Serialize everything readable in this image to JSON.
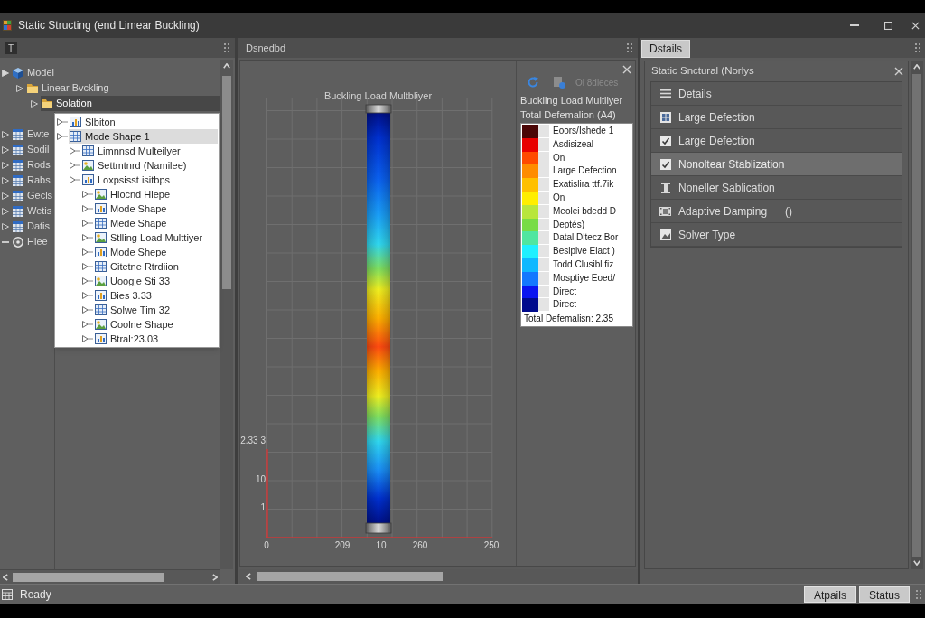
{
  "window": {
    "title": "Static Structing (end Limear Buckling)"
  },
  "left_panel": {
    "toolbar_button": "T",
    "tree": [
      {
        "label": "Model",
        "kind": "branch",
        "expanded": true,
        "selected": false,
        "children": [
          {
            "label": "Linear Bvckling",
            "kind": "branch",
            "expanded": false,
            "selected": false,
            "children": [
              {
                "label": "Solation",
                "kind": "branch",
                "expanded": false,
                "selected": true
              }
            ]
          }
        ]
      },
      {
        "label": "Ewte",
        "kind": "branch",
        "expanded": false,
        "selected": false
      },
      {
        "label": "Sodil",
        "kind": "branch",
        "expanded": false,
        "selected": false
      },
      {
        "label": "Rods",
        "kind": "branch",
        "expanded": false,
        "selected": false
      },
      {
        "label": "Rabs",
        "kind": "branch",
        "expanded": false,
        "selected": false
      },
      {
        "label": "Gecls",
        "kind": "branch",
        "expanded": false,
        "selected": false
      },
      {
        "label": "Wetis",
        "kind": "branch",
        "expanded": false,
        "selected": false
      },
      {
        "label": "Datis",
        "kind": "branch",
        "expanded": false,
        "selected": false
      },
      {
        "label": "Hiee",
        "kind": "leaf",
        "selected": false
      }
    ],
    "popup_tree": [
      {
        "label": "Slbiton",
        "kind": "branch",
        "expanded": false,
        "selected": false
      },
      {
        "label": "Mode Shape 1",
        "kind": "branch",
        "expanded": false,
        "selected": true,
        "children": [
          {
            "label": "Limnnsd Multeilyer",
            "kind": "branch",
            "expanded": false,
            "selected": false
          },
          {
            "label": "Settmtnrd (Namilee)",
            "kind": "branch",
            "expanded": false,
            "selected": false
          },
          {
            "label": "Loxpsisst isitbps",
            "kind": "branch",
            "expanded": false,
            "selected": false,
            "children": [
              {
                "label": "Hlocnd Hiepe",
                "kind": "branch",
                "expanded": false,
                "selected": false
              },
              {
                "label": "Mode Shape",
                "kind": "branch",
                "expanded": false,
                "selected": false
              },
              {
                "label": "Mede Shape",
                "kind": "branch",
                "expanded": false,
                "selected": false
              },
              {
                "label": "Stlling Load Multtiyer",
                "kind": "branch",
                "expanded": false,
                "selected": false
              },
              {
                "label": "Mode Shepe",
                "kind": "branch",
                "expanded": false,
                "selected": false
              },
              {
                "label": "Citetne Rtrdiion",
                "kind": "branch",
                "expanded": false,
                "selected": false
              },
              {
                "label": "Uoogje Sti 33",
                "kind": "branch",
                "expanded": false,
                "selected": false
              },
              {
                "label": "Bies 3.33",
                "kind": "branch",
                "expanded": false,
                "selected": false
              },
              {
                "label": "Solwe Tim 32",
                "kind": "branch",
                "expanded": false,
                "selected": false
              },
              {
                "label": "Coolne Shape",
                "kind": "branch",
                "expanded": false,
                "selected": false
              },
              {
                "label": "Btral:23.03",
                "kind": "branch",
                "expanded": false,
                "selected": false
              }
            ]
          }
        ]
      }
    ]
  },
  "center_panel": {
    "title": "Dsnedbd",
    "plot": {
      "title": "Buckling Load Multbliyer",
      "y_ticks": [
        "2.33 3",
        "10",
        "1"
      ],
      "x_ticks": [
        "0",
        "209",
        "10",
        "260",
        "250"
      ]
    },
    "legend": {
      "tool": {
        "label": "Oi 8dieces",
        "disabled": true
      },
      "title": "Buckling Load Multilyer",
      "subtitle": "Total Defemalion (A4)",
      "entries": [
        {
          "label": "Eoors/Ishede 1",
          "color": "#4a0505"
        },
        {
          "label": "Asdisizeal",
          "color": "#e80000"
        },
        {
          "label": "On",
          "color": "#ff4a00"
        },
        {
          "label": "Large Defection",
          "color": "#ff8c00"
        },
        {
          "label": "Exatislira ttf.7ik",
          "color": "#ffc000"
        },
        {
          "label": "On",
          "color": "#ffee00"
        },
        {
          "label": "Meolei bdedd D",
          "color": "#b8e63c"
        },
        {
          "label": "Deptés)",
          "color": "#78dc46"
        },
        {
          "label": "Datal Dltecz Bor",
          "color": "#50e6a0"
        },
        {
          "label": "Besipive Elact )",
          "color": "#20f0ff"
        },
        {
          "label": "Todd Clusibl fiz",
          "color": "#10b8ff"
        },
        {
          "label": "Mosptiye Eoed/",
          "color": "#1478ff"
        },
        {
          "label": "Direct",
          "color": "#0a14f0"
        },
        {
          "label": "Direct",
          "color": "#000a8c"
        }
      ],
      "footer": "Total Defemalisn: 2.35"
    }
  },
  "right_panel": {
    "tabs": [
      {
        "label": "Dstails",
        "selected": true
      }
    ],
    "title": "Static Snctural (Norlys",
    "rows": [
      {
        "label": "Details",
        "selected": false
      },
      {
        "label": "Large Defection",
        "selected": false
      },
      {
        "label": "Large Defection",
        "selected": false
      },
      {
        "label": "Nonoltear Stablization",
        "selected": true
      },
      {
        "label": "Noneller Sablication",
        "selected": false
      },
      {
        "label": "Adaptive Damping",
        "value": "()",
        "selected": false
      },
      {
        "label": "Solver Type",
        "selected": false
      }
    ]
  },
  "status_bar": {
    "text": "Ready",
    "buttons": [
      "Atpails",
      "Status"
    ]
  }
}
